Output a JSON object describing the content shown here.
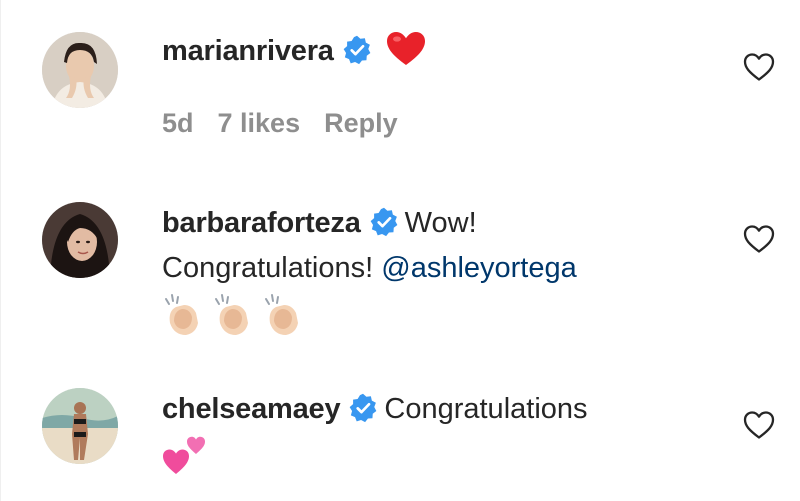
{
  "comments": [
    {
      "username": "marianrivera",
      "verified": true,
      "text": "",
      "emoji": "red-heart",
      "meta": {
        "time": "5d",
        "likes": "7 likes",
        "reply": "Reply"
      }
    },
    {
      "username": "barbaraforteza",
      "verified": true,
      "text_line1": "Wow!",
      "text_line2": "Congratulations!",
      "mention": "@ashleyortega",
      "emoji": "clapping-hands x3"
    },
    {
      "username": "chelseamaey",
      "verified": true,
      "text": "Congratulations",
      "emoji": "two-hearts"
    }
  ],
  "colors": {
    "text": "#262626",
    "meta": "#8e8e8e",
    "verified_badge": "#3897f0",
    "mention": "#00376b",
    "heart_outline": "#262626"
  },
  "icons": [
    "verified-badge-icon",
    "heart-outline-icon",
    "red-heart-emoji",
    "clapping-hands-emoji",
    "two-hearts-emoji"
  ]
}
